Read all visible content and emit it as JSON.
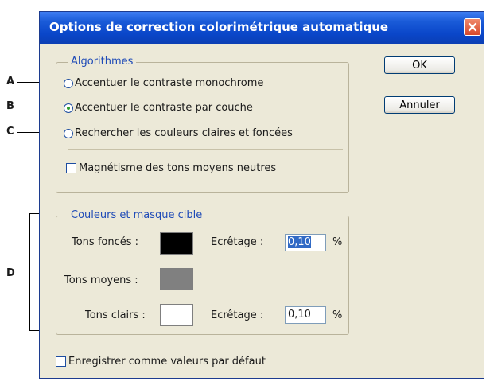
{
  "dialog": {
    "title": "Options de correction colorimétrique automatique",
    "ok_label": "OK",
    "cancel_label": "Annuler"
  },
  "algorithms": {
    "legend": "Algorithmes",
    "options": [
      {
        "label": "Accentuer le contraste monochrome",
        "selected": false
      },
      {
        "label": "Accentuer le contraste par couche",
        "selected": true
      },
      {
        "label": "Rechercher les couleurs claires et foncées",
        "selected": false
      }
    ],
    "neutral_midtones_label": "Magnétisme des tons moyens neutres",
    "neutral_midtones_checked": false
  },
  "target_colors": {
    "legend": "Couleurs et masque cible",
    "shadows_label": "Tons foncés :",
    "shadows_color": "#000000",
    "shadows_clip_label": "Ecrêtage :",
    "shadows_clip_value": "0,10",
    "midtones_label": "Tons moyens :",
    "midtones_color": "#808080",
    "highlights_label": "Tons clairs :",
    "highlights_color": "#ffffff",
    "highlights_clip_label": "Ecrêtage :",
    "highlights_clip_value": "0,10",
    "percent_sign": "%"
  },
  "save_defaults_label": "Enregistrer comme valeurs par défaut",
  "save_defaults_checked": false,
  "callouts": [
    "A",
    "B",
    "C",
    "D"
  ]
}
